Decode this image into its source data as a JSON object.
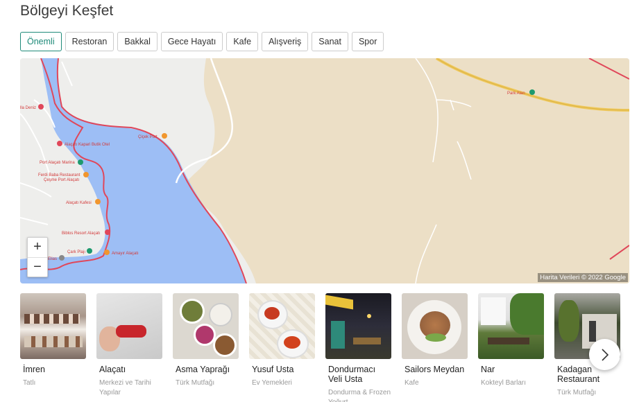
{
  "page": {
    "title": "Bölgeyi Keşfet"
  },
  "filters": [
    "Önemli",
    "Restoran",
    "Bakkal",
    "Gece Hayatı",
    "Kafe",
    "Alışveriş",
    "Sanat",
    "Spor"
  ],
  "active_filter": "Önemli",
  "map": {
    "attribution": "Harita Verileri © 2022 Google",
    "zoom_in": "+",
    "zoom_out": "−",
    "places": [
      "Alaçatı Kapari Butik Otel",
      "Port Alaçatı Marina",
      "Ferdi Baba Restaurant",
      "Çeşme Port Alaçatı",
      "Alaçatı Kafesi",
      "Biblos Resort Alaçatı",
      "Çark Plajı",
      "Amayır Alaçatı",
      "Park Alan",
      "Çiçek Port",
      "Elias",
      "lla Deniz"
    ]
  },
  "places": [
    {
      "name": "İmren",
      "category": "Tatlı"
    },
    {
      "name": "Alaçatı",
      "category": "Merkezi ve Tarihi Yapılar"
    },
    {
      "name": "Asma Yaprağı",
      "category": "Türk Mutfağı"
    },
    {
      "name": "Yusuf Usta",
      "category": "Ev Yemekleri"
    },
    {
      "name": "Dondurmacı Veli Usta",
      "category": "Dondurma & Frozen Yoğurt"
    },
    {
      "name": "Sailors Meydan",
      "category": "Kafe"
    },
    {
      "name": "Nar",
      "category": "Kokteyl Barları"
    },
    {
      "name": "Kadagan Restaurant",
      "category": "Türk Mutfağı"
    }
  ],
  "icons": {
    "next": "chevron-right-icon",
    "pin": "map-pin-icon"
  }
}
